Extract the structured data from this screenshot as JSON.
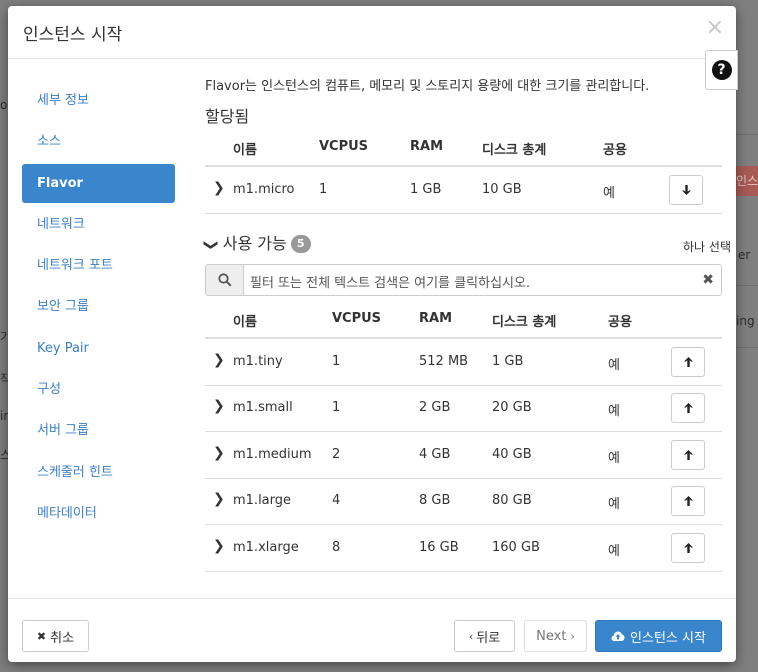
{
  "modal": {
    "title": "인스턴스 시작",
    "close_glyph": "×",
    "help_glyph": "?"
  },
  "background": {
    "red_button_text": "인스",
    "side_texts": [
      "ou",
      "er",
      "ing",
      "기록",
      "작",
      "ir",
      "스"
    ]
  },
  "sidebar": {
    "items": [
      {
        "label": "세부 정보",
        "active": false
      },
      {
        "label": "소스",
        "active": false
      },
      {
        "label": "Flavor",
        "active": true
      },
      {
        "label": "네트워크",
        "active": false
      },
      {
        "label": "네트워크 포트",
        "active": false
      },
      {
        "label": "보안 그룹",
        "active": false
      },
      {
        "label": "Key Pair",
        "active": false
      },
      {
        "label": "구성",
        "active": false
      },
      {
        "label": "서버 그룹",
        "active": false
      },
      {
        "label": "스케줄러 힌트",
        "active": false
      },
      {
        "label": "메타데이터",
        "active": false
      }
    ]
  },
  "main": {
    "intro": "Flavor는 인스턴스의 컴퓨트, 메모리 및 스토리지 용량에 대한 크기를 관리합니다.",
    "allocated": {
      "title": "할당됨",
      "columns": [
        "이름",
        "VCPUS",
        "RAM",
        "디스크 총계",
        "공용"
      ],
      "rows": [
        {
          "name": "m1.micro",
          "vcpus": "1",
          "ram": "1 GB",
          "disk": "10 GB",
          "public": "예",
          "action_icon": "arrow-down-icon"
        }
      ]
    },
    "available": {
      "title": "사용 가능",
      "count": "5",
      "select_hint": "하나 선택",
      "search_placeholder": "필터 또는 전체 텍스트 검색은 여기를 클릭하십시오.",
      "columns": [
        "이름",
        "VCPUS",
        "RAM",
        "디스크 총계",
        "공용"
      ],
      "rows": [
        {
          "name": "m1.tiny",
          "vcpus": "1",
          "ram": "512 MB",
          "disk": "1 GB",
          "public": "예",
          "action_icon": "arrow-up-icon"
        },
        {
          "name": "m1.small",
          "vcpus": "1",
          "ram": "2 GB",
          "disk": "20 GB",
          "public": "예",
          "action_icon": "arrow-up-icon"
        },
        {
          "name": "m1.medium",
          "vcpus": "2",
          "ram": "4 GB",
          "disk": "40 GB",
          "public": "예",
          "action_icon": "arrow-up-icon"
        },
        {
          "name": "m1.large",
          "vcpus": "4",
          "ram": "8 GB",
          "disk": "80 GB",
          "public": "예",
          "action_icon": "arrow-up-icon"
        },
        {
          "name": "m1.xlarge",
          "vcpus": "8",
          "ram": "16 GB",
          "disk": "160 GB",
          "public": "예",
          "action_icon": "arrow-up-icon"
        }
      ]
    }
  },
  "footer": {
    "cancel_label": "취소",
    "back_label": "뒤로",
    "next_label": "Next",
    "launch_label": "인스턴스 시작"
  },
  "colors": {
    "primary": "#3a86cc",
    "link": "#3a7fc6",
    "danger_bg": "#a85a55"
  }
}
